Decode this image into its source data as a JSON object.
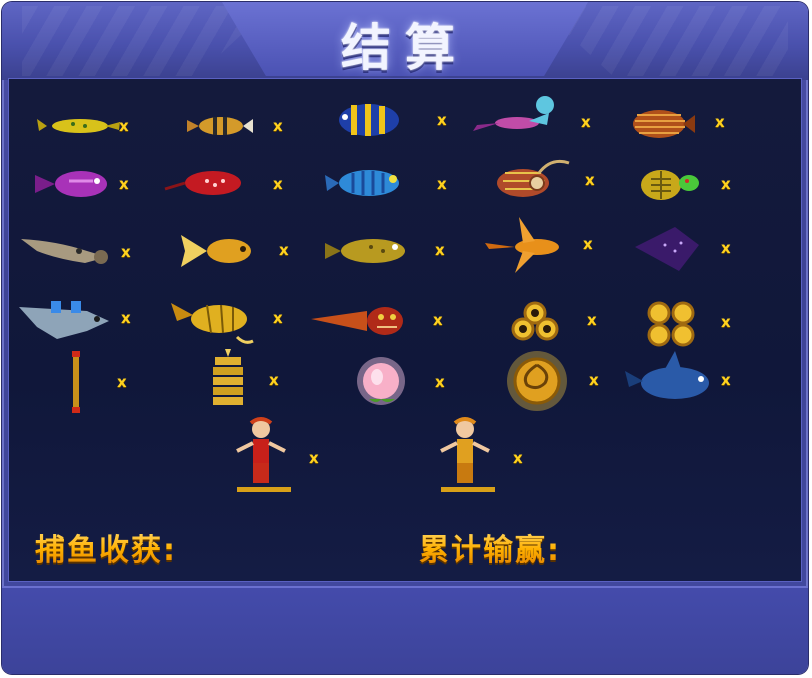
{
  "title": "结算",
  "stats": {
    "catch_label": "捕鱼收获:",
    "total_label": "累计输赢:"
  },
  "items": [
    {
      "icon": "yellow-lizard-fish-icon",
      "multiplier": "x"
    },
    {
      "icon": "striped-small-fish-icon",
      "multiplier": "x"
    },
    {
      "icon": "blue-yellow-angelfish-icon",
      "multiplier": "x"
    },
    {
      "icon": "flying-lionfish-icon",
      "multiplier": "x"
    },
    {
      "icon": "orange-striped-fish-icon",
      "multiplier": "x"
    },
    {
      "icon": "purple-fish-icon",
      "multiplier": "x"
    },
    {
      "icon": "red-spotted-ray-icon",
      "multiplier": "x"
    },
    {
      "icon": "blue-striped-fish-icon",
      "multiplier": "x"
    },
    {
      "icon": "lantern-anglerfish-icon",
      "multiplier": "x"
    },
    {
      "icon": "sea-turtle-icon",
      "multiplier": "x"
    },
    {
      "icon": "sawfish-icon",
      "multiplier": "x"
    },
    {
      "icon": "goldfish-icon",
      "multiplier": "x"
    },
    {
      "icon": "yellow-grouper-icon",
      "multiplier": "x"
    },
    {
      "icon": "orange-flying-fish-icon",
      "multiplier": "x"
    },
    {
      "icon": "purple-manta-ray-icon",
      "multiplier": "x"
    },
    {
      "icon": "armored-silver-shark-icon",
      "multiplier": "x"
    },
    {
      "icon": "golden-dragon-fish-icon",
      "multiplier": "x"
    },
    {
      "icon": "red-dragon-head-fish-icon",
      "multiplier": "x"
    },
    {
      "icon": "triple-gold-coin-icon",
      "multiplier": "x"
    },
    {
      "icon": "quad-gold-coin-icon",
      "multiplier": "x"
    },
    {
      "icon": "golden-staff-icon",
      "multiplier": "x"
    },
    {
      "icon": "golden-pagoda-icon",
      "multiplier": "x"
    },
    {
      "icon": "glowing-peach-icon",
      "multiplier": "x"
    },
    {
      "icon": "golden-medallion-icon",
      "multiplier": "x"
    },
    {
      "icon": "blue-whale-icon",
      "multiplier": "x"
    },
    {
      "icon": "red-monkey-king-icon",
      "multiplier": "x"
    },
    {
      "icon": "gold-monkey-king-icon",
      "multiplier": "x"
    }
  ]
}
